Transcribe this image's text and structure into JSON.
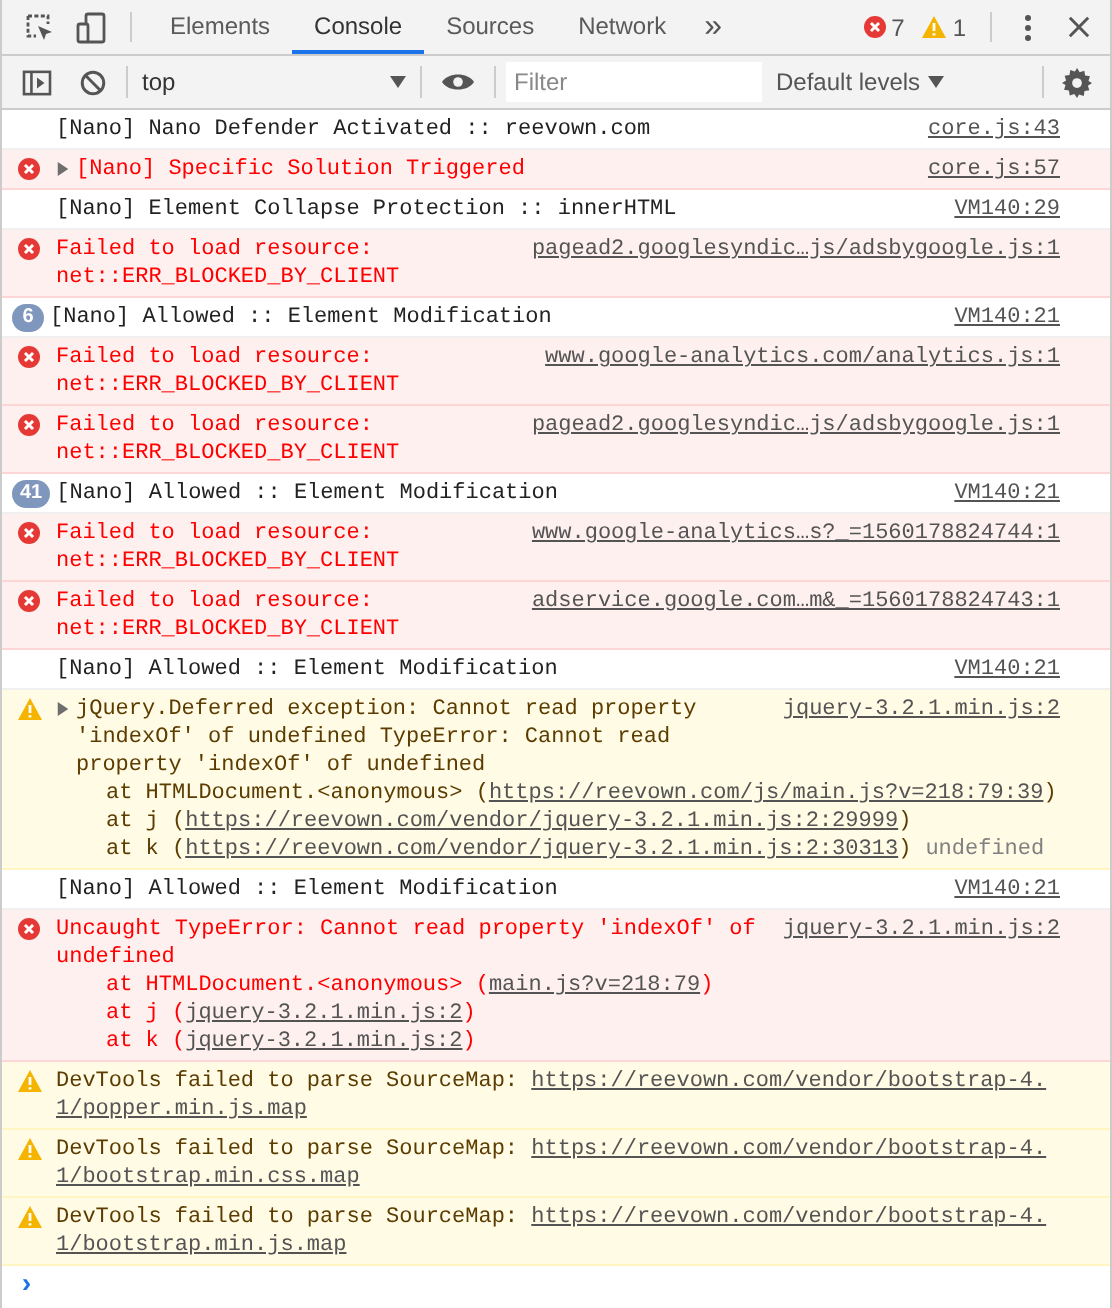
{
  "tabs": [
    {
      "label": "Elements",
      "selected": false
    },
    {
      "label": "Console",
      "selected": true
    },
    {
      "label": "Sources",
      "selected": false
    },
    {
      "label": "Network",
      "selected": false
    }
  ],
  "more_tabs": "»",
  "error_count": "7",
  "warning_count": "1",
  "console_toolbar": {
    "context": "top",
    "filter": {
      "placeholder": "Filter"
    },
    "levels": "Default levels"
  },
  "messages": [
    {
      "kind": "log",
      "text": "[Nano] Nano Defender Activated :: reevown.com",
      "source": "core.js:43"
    },
    {
      "kind": "error",
      "expanded": false,
      "text": "[Nano] Specific Solution Triggered",
      "source": "core.js:57"
    },
    {
      "kind": "log",
      "text": "[Nano] Element Collapse Protection :: innerHTML",
      "source": "VM140:29"
    },
    {
      "kind": "error",
      "text": "Failed to load resource: net::ERR_BLOCKED_BY_CLIENT",
      "source": "pagead2.googlesyndic…js/adsbygoogle.js:1"
    },
    {
      "kind": "log",
      "count": "6",
      "text": "[Nano] Allowed :: Element Modification",
      "source": "VM140:21"
    },
    {
      "kind": "error",
      "text": "Failed to load resource: net::ERR_BLOCKED_BY_CLIENT",
      "source": "www.google-analytics.com/analytics.js:1"
    },
    {
      "kind": "error",
      "text": "Failed to load resource: net::ERR_BLOCKED_BY_CLIENT",
      "source": "pagead2.googlesyndic…js/adsbygoogle.js:1"
    },
    {
      "kind": "log",
      "count": "41",
      "text": "[Nano] Allowed :: Element Modification",
      "source": "VM140:21"
    },
    {
      "kind": "error",
      "text": "Failed to load resource: net::ERR_BLOCKED_BY_CLIENT",
      "source": "www.google-analytics…s?_=1560178824744:1"
    },
    {
      "kind": "error",
      "text": "Failed to load resource: net::ERR_BLOCKED_BY_CLIENT",
      "source": "adservice.google.com…m&_=1560178824743:1"
    },
    {
      "kind": "log",
      "text": "[Nano] Allowed :: Element Modification",
      "source": "VM140:21"
    },
    {
      "kind": "warning",
      "expanded": false,
      "text": "jQuery.Deferred exception: Cannot read property 'indexOf' of undefined TypeError: Cannot read property 'indexOf' of undefined",
      "source": "jquery-3.2.1.min.js:2",
      "stack": [
        {
          "prefix": "at HTMLDocument.<anonymous> (",
          "link": "https://reevown.com/js/main.js?v=218:79:39",
          "suffix": ")"
        },
        {
          "prefix": "at j (",
          "link": "https://reevown.com/vendor/jquery-3.2.1.min.js:2:29999",
          "suffix": ")"
        },
        {
          "prefix": "at k (",
          "link": "https://reevown.com/vendor/jquery-3.2.1.min.js:2:30313",
          "suffix": ")"
        }
      ],
      "trailing": "undefined"
    },
    {
      "kind": "log",
      "text": "[Nano] Allowed :: Element Modification",
      "source": "VM140:21"
    },
    {
      "kind": "error",
      "text": "Uncaught TypeError: Cannot read property 'indexOf' of undefined",
      "source": "jquery-3.2.1.min.js:2",
      "stack": [
        {
          "prefix": "at HTMLDocument.<anonymous> (",
          "link": "main.js?v=218:79",
          "suffix": ")"
        },
        {
          "prefix": "at j (",
          "link": "jquery-3.2.1.min.js:2",
          "suffix": ")"
        },
        {
          "prefix": "at k (",
          "link": "jquery-3.2.1.min.js:2",
          "suffix": ")"
        }
      ]
    },
    {
      "kind": "warning",
      "text": "DevTools failed to parse SourceMap: ",
      "link": "https://reevown.com/vendor/bootstrap-4.1/popper.min.js.map"
    },
    {
      "kind": "warning",
      "text": "DevTools failed to parse SourceMap: ",
      "link": "https://reevown.com/vendor/bootstrap-4.1/bootstrap.min.css.map"
    },
    {
      "kind": "warning",
      "text": "DevTools failed to parse SourceMap: ",
      "link": "https://reevown.com/vendor/bootstrap-4.1/bootstrap.min.js.map"
    }
  ],
  "prompt": "›"
}
